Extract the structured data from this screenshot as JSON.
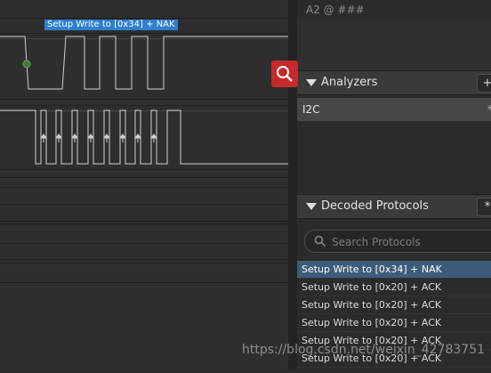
{
  "timing": {
    "label": "A2  @  ###"
  },
  "annotation": {
    "label": "Setup Write to [0x34] + NAK"
  },
  "analyzers": {
    "title": "Analyzers",
    "add_button": "+",
    "items": [
      {
        "label": "I2C",
        "settings_glyph": "*"
      }
    ]
  },
  "decoded": {
    "title": "Decoded Protocols",
    "settings_glyph": "*",
    "search_placeholder": "Search Protocols",
    "results": [
      "Setup Write to [0x34] + NAK",
      "Setup Write to [0x20] + ACK",
      "Setup Write to [0x20] + ACK",
      "Setup Write to [0x20] + ACK",
      "Setup Write to [0x20] + ACK",
      "Setup Write to [0x20] + ACK"
    ],
    "selected_index": 0
  },
  "zoom": {
    "icon": "magnifier-icon"
  },
  "watermark": "https://blog.csdn.net/weixin_42783751",
  "colors": {
    "selection": "#3d5c79",
    "annotation": "#2e7fcf",
    "zoom": "#c62a2a",
    "signal": "#d0d0d0",
    "marker": "#3c7a3c"
  }
}
